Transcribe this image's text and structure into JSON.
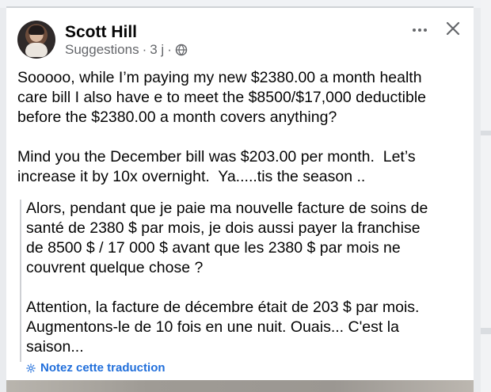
{
  "post": {
    "author": "Scott Hill",
    "context": "Suggestions",
    "time": "3 j",
    "text": "Sooooo, while I’m paying my new $2380.00 a month health\ncare bill I also have e to meet the $8500/$17,000 deductible\nbefore the $2380.00 a month covers anything?\n\nMind you the December bill was $203.00 per month.  Let’s\nincrease it by 10x overnight.  Ya.....tis the season ..",
    "translation": "Alors, pendant que je paie ma nouvelle facture de soins de\nsanté de 2380 $ par mois, je dois aussi payer la franchise\nde 8500 $ / 17 000 $ avant que les 2380 $ par mois ne\ncouvrent quelque chose ?\n\nAttention, la facture de décembre était de 203 $ par mois.\nAugmentons-le de 10 fois en une nuit. Ouais... C'est la\nsaison...",
    "rate_translation": "Notez cette traduction",
    "icons": {
      "privacy": "globe-icon",
      "more": "more-options-icon",
      "close": "close-icon",
      "rate": "gear-icon"
    }
  },
  "colors": {
    "link": "#216fdb",
    "meta": "#65676b",
    "text": "#050505"
  }
}
